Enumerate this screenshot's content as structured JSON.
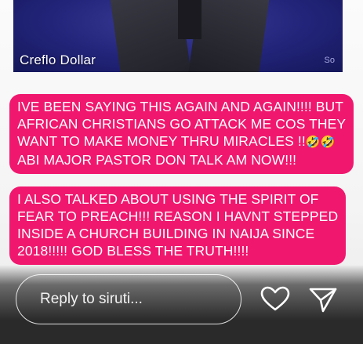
{
  "story": {
    "video_caption": "Creflo Dollar",
    "watermark": "So",
    "blocks": [
      {
        "lines": [
          "IVE BEEN SAYING THIS AGAIN AND AGAIN!!!! BUT",
          "AFRICAN CHRISTIANS GO ATTACK ME COS THEY",
          "WANT TO MAKE MONEY THRU MIRACLES !!",
          "ABI MAJOR PASTOR DON TALK AM NOW!!!"
        ],
        "emojis": [
          "🤣",
          "🤣"
        ]
      },
      {
        "lines": [
          "I ALSO TALKED ABOUT USING THE SPIRIT OF",
          "FEAR TO PREACH!!! REASON I HAVNT  STEPPED",
          "INSIDE A CHURCH BUILDING IN NAIJA SINCE",
          "2018!!!!! GOD BLESS THE TRUTH!!!!"
        ]
      }
    ]
  },
  "reply_bar": {
    "placeholder": "Reply to siruti...",
    "like_icon": "heart-icon",
    "send_icon": "send-icon"
  },
  "colors": {
    "text_highlight": "#f0186e",
    "text": "#ffffff",
    "video_bg": "#22247a"
  }
}
